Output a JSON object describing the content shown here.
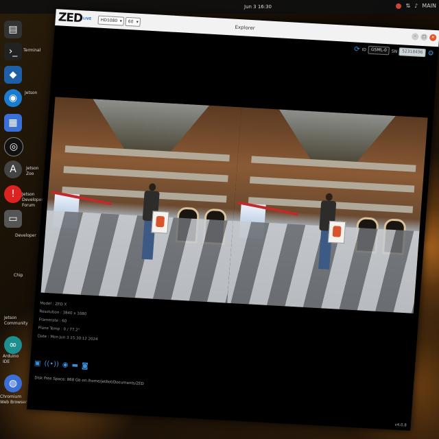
{
  "topbar": {
    "clock": "Jun 3 16:30",
    "user": "MAIN"
  },
  "dock": {
    "labels": [
      "Terminal",
      "Jetson",
      "Jetson Zoo",
      "Jetson Developers Forum",
      "Developer",
      "Chip",
      "Jetson Community",
      "Arduino IDE",
      "Chromium Web Browser"
    ]
  },
  "window": {
    "logo": "ZED",
    "live": "LIVE",
    "resolution_select": "HD1080",
    "fps_select": "60",
    "title": "Explorer",
    "camera_id_label": "ID",
    "camera_id_value": "GSML-0",
    "sn_label": "SN",
    "sn_value": "52318496"
  },
  "info": {
    "model": "Model : ZED X",
    "resolution": "Resolution : 3840 x 1080",
    "framerate": "Framerate : 60",
    "plane_temp": "Plane Temp : 0 / 77.2°",
    "date": "Date : Mon Jun 3 15:30:12 2024"
  },
  "footer": {
    "disk": "Disk Free Space: 868 Gb  on  /home/jetbot/Documents/ZED",
    "version": "v4.0.8"
  },
  "colors": {
    "accent": "#3a8fd8",
    "close": "#e2572c"
  }
}
